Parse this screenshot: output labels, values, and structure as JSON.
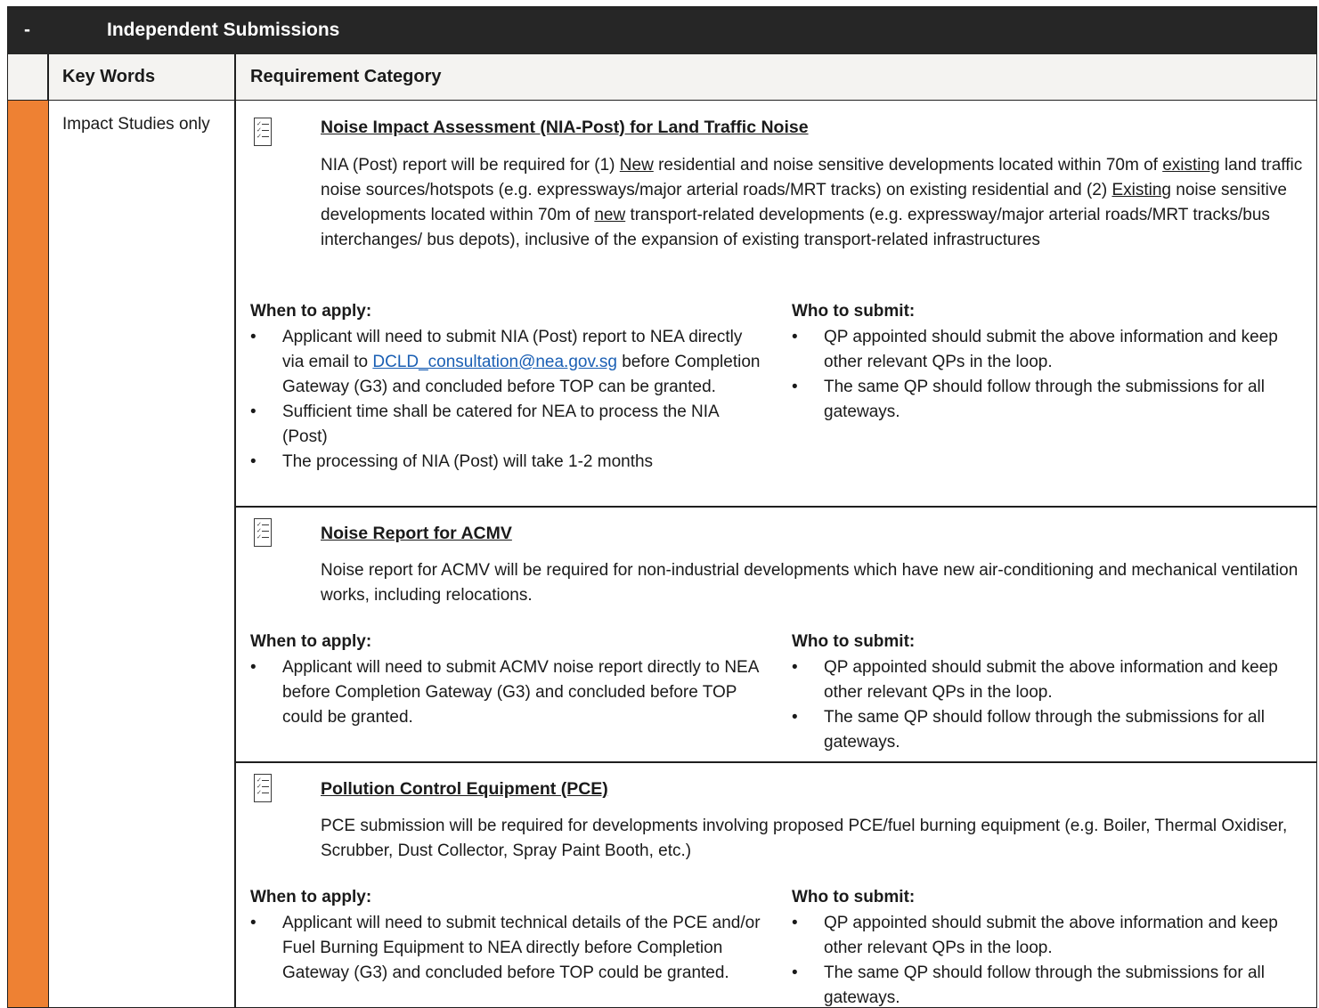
{
  "header": {
    "collapse_symbol": "-",
    "title": "Independent Submissions",
    "col_keywords": "Key Words",
    "col_category": "Requirement Category"
  },
  "keywords": "Impact Studies only",
  "labels": {
    "when": "When to apply:",
    "who": "Who to submit:",
    "bullet": "•"
  },
  "sections": [
    {
      "icon": "checklist-icon",
      "title": "Noise Impact Assessment (NIA-Post) for Land Traffic Noise",
      "desc_parts": [
        "NIA (Post) report will be required for (1) ",
        "New",
        " residential and noise sensitive developments located within 70m of ",
        "existing",
        " land traffic noise sources/hotspots (e.g. expressways/major arterial roads/MRT tracks) on existing residential and (2) ",
        "Existing",
        " noise sensitive developments located within 70m of ",
        "new",
        " transport-related developments (e.g. expressway/major arterial roads/MRT tracks/bus interchanges/ bus depots), inclusive of the expansion of existing transport-related infrastructures"
      ],
      "when": [
        {
          "pre": "Applicant will need to submit NIA (Post) report to NEA directly via email to ",
          "link": "DCLD_consultation@nea.gov.sg",
          "post": " before Completion Gateway (G3) and concluded before TOP can be granted."
        },
        {
          "pre": "Sufficient time shall be catered for NEA to process the NIA (Post)"
        },
        {
          "pre": "The processing of NIA (Post) will take 1-2 months"
        }
      ],
      "who": [
        "QP appointed should submit the above information and keep other relevant QPs in the loop.",
        "The same QP should follow through the submissions for all gateways."
      ]
    },
    {
      "icon": "checklist-icon",
      "title": "Noise Report for ACMV",
      "desc": "Noise report for ACMV will be required for non-industrial developments which have new air-conditioning and mechanical ventilation works, including relocations.",
      "when": [
        "Applicant will need to submit ACMV noise report directly to NEA before Completion Gateway (G3) and concluded before TOP could be granted."
      ],
      "who": [
        "QP appointed should submit the above information and keep other relevant QPs in the loop.",
        "The same QP should follow through the submissions for all gateways."
      ]
    },
    {
      "icon": "checklist-icon",
      "title": "Pollution Control Equipment (PCE)",
      "desc": "PCE submission will be required for developments involving proposed PCE/fuel burning equipment (e.g. Boiler, Thermal Oxidiser, Scrubber, Dust Collector, Spray Paint Booth, etc.)",
      "when": [
        "Applicant will need to submit technical details of the PCE and/or Fuel Burning Equipment to NEA directly before Completion Gateway (G3) and concluded before TOP could be granted."
      ],
      "who": [
        "QP appointed should submit the above information and keep other relevant QPs in the loop.",
        "The same QP should follow through the submissions for all gateways."
      ]
    }
  ]
}
